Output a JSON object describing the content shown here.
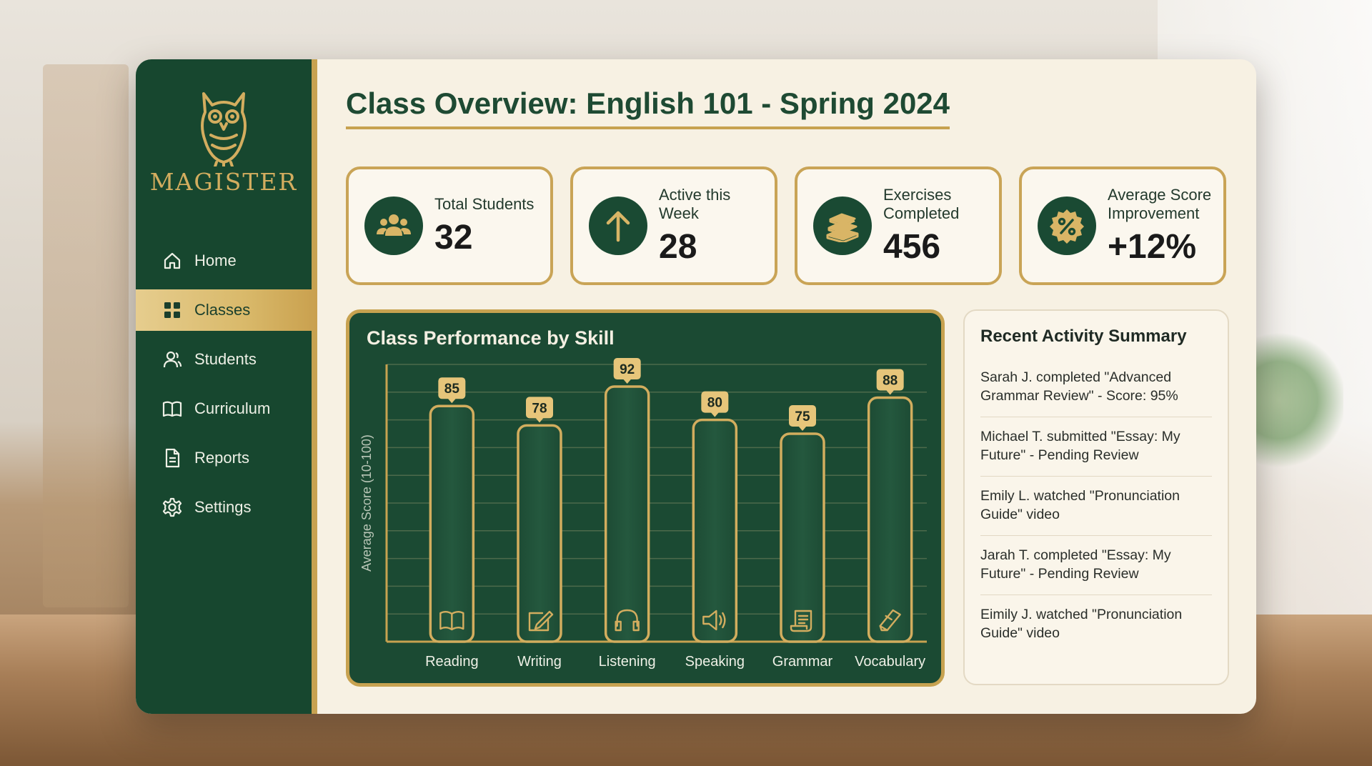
{
  "brand": {
    "name": "MAGISTER"
  },
  "sidebar": {
    "items": [
      {
        "label": "Home",
        "icon": "home-icon"
      },
      {
        "label": "Classes",
        "icon": "grid-icon",
        "active": true
      },
      {
        "label": "Students",
        "icon": "user-icon"
      },
      {
        "label": "Curriculum",
        "icon": "book-icon"
      },
      {
        "label": "Reports",
        "icon": "document-icon"
      },
      {
        "label": "Settings",
        "icon": "gear-icon"
      }
    ]
  },
  "header": {
    "title": "Class Overview: English 101 - Spring 2024"
  },
  "stats": [
    {
      "label": "Total Students",
      "value": "32",
      "icon": "people-icon"
    },
    {
      "label": "Active this Week",
      "value": "28",
      "icon": "arrow-up-icon"
    },
    {
      "label": "Exercises Completed",
      "value": "456",
      "icon": "books-stack-icon"
    },
    {
      "label": "Average Score Improvement",
      "value": "+12%",
      "icon": "percent-badge-icon"
    }
  ],
  "chart": {
    "title": "Class Performance by Skill"
  },
  "chart_data": {
    "type": "bar",
    "title": "Class Performance by Skill",
    "ylabel": "Average Score (10-100)",
    "xlabel": "",
    "categories": [
      "Reading",
      "Writing",
      "Listening",
      "Speaking",
      "Grammar",
      "Vocabulary"
    ],
    "values": [
      85,
      78,
      92,
      80,
      75,
      88
    ],
    "icons": [
      "open-book-icon",
      "pencil-icon",
      "headphones-icon",
      "speaker-icon",
      "scroll-icon",
      "books-icon"
    ],
    "ylim": [
      0,
      100
    ],
    "grid": true,
    "colors": {
      "bar": "#24583e",
      "outline": "#d2ad5e",
      "label_bg": "#e6c57a"
    }
  },
  "activity": {
    "title": "Recent Activity Summary",
    "items": [
      "Sarah J. completed \"Advanced Grammar Review\" - Score: 95%",
      "Michael T. submitted \"Essay: My Future\" - Pending Review",
      "Emily L. watched \"Pronunciation Guide\" video",
      "Jarah T. completed \"Essay: My Future\" - Pending Review",
      "Eimily J. watched \"Pronunciation Guide\" video"
    ]
  },
  "colors": {
    "primary": "#17472f",
    "accent": "#c7a250",
    "background": "#f7f1e3"
  }
}
